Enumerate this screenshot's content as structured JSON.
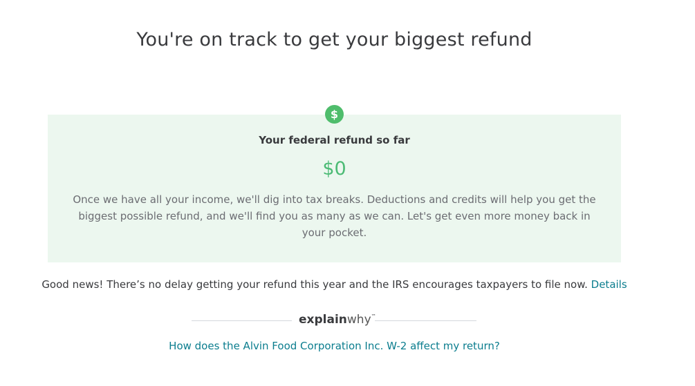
{
  "header": {
    "title": "You're on track to get your biggest refund"
  },
  "refund_card": {
    "icon": "dollar-icon",
    "icon_glyph": "$",
    "label": "Your federal refund so far",
    "amount": "$0",
    "body": "Once we have all your income, we'll dig into tax breaks. Deductions and credits will help you get the biggest possible refund, and we'll find you as many as we can. Let's get even more money back in your pocket.",
    "background_color": "#ecf7ef",
    "amount_color": "#4cbb75"
  },
  "news": {
    "strong": "Good news!",
    "text": " There’s no delay getting your refund this year and the IRS encourages taxpayers to file now. ",
    "link_label": "Details"
  },
  "explainwhy": {
    "bold": "explain",
    "light": "why",
    "tm": "™"
  },
  "question_link": "How does the Alvin Food Corporation Inc. W-2 affect my return?",
  "colors": {
    "link": "#0b7d8e",
    "text": "#393a3d"
  }
}
